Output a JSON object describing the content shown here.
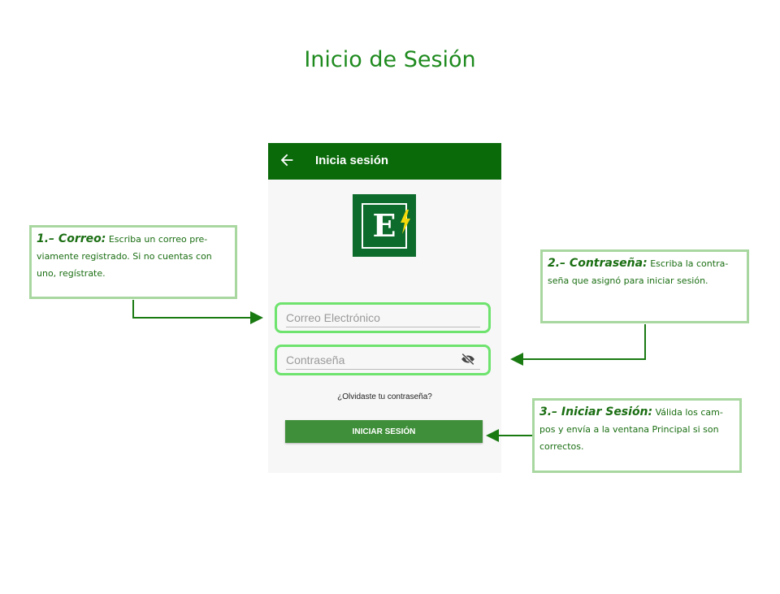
{
  "page": {
    "title": "Inicio de Sesión"
  },
  "app": {
    "appbar_title": "Inicia sesión",
    "logo_letter": "E",
    "email_placeholder": "Correo Electrónico",
    "password_placeholder": "Contraseña",
    "forgot_link": "¿Olvidaste tu contraseña?",
    "login_button": "INICIAR SESIÓN"
  },
  "callouts": [
    {
      "heading": "1.– Correo:",
      "text": "Escriba un correo pre-viamente registrado. Si no cuentas con uno, regístrate."
    },
    {
      "heading": "2.– Contraseña:",
      "text": "Escriba la contra-seña que asignó para iniciar sesión."
    },
    {
      "heading": "3.– Iniciar Sesión:",
      "text": "Válida los cam-pos y envía a la ventana Principal si son correctos."
    }
  ],
  "colors": {
    "brand_green": "#0a6a0a",
    "title_green": "#1e8a1e",
    "field_highlight": "#6ee36e",
    "button_green": "#3f8f3a",
    "callout_border": "#a9d7a0"
  },
  "icons": [
    "arrow-back-icon",
    "visibility-off-icon",
    "bolt-icon"
  ]
}
